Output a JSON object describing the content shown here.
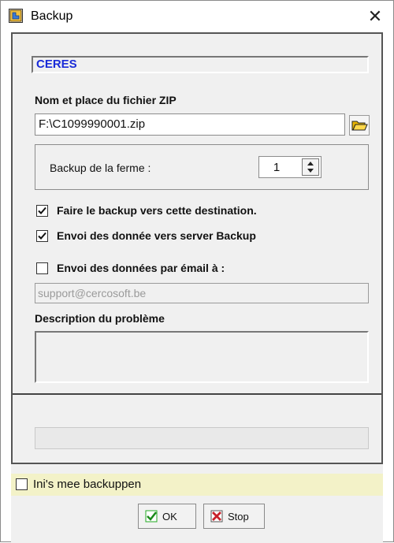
{
  "window": {
    "title": "Backup",
    "close_glyph": "✕"
  },
  "company": {
    "name": "CERES"
  },
  "zip": {
    "label": "Nom et place du fichier ZIP",
    "value": "F:\\C1099990001.zip"
  },
  "farm": {
    "label": "Backup de la ferme :",
    "value": "1"
  },
  "options": {
    "destination": {
      "label": "Faire le backup vers cette destination.",
      "checked": true
    },
    "server": {
      "label": "Envoi des donnée vers server Backup",
      "checked": true
    },
    "email": {
      "label": "Envoi des données par émail à :",
      "checked": false
    }
  },
  "email_field": {
    "value": "support@cercosoft.be"
  },
  "problem": {
    "label": "Description du problème",
    "value": ""
  },
  "ini": {
    "label": "Ini's mee backuppen",
    "checked": false
  },
  "buttons": {
    "ok": "OK",
    "stop": "Stop"
  },
  "colors": {
    "company_text": "#1a2bd8",
    "ini_bg": "#f3f2c8",
    "panel_bg": "#f0f0f0"
  },
  "icons": {
    "app": "backup-app-icon",
    "folder": "folder-open-icon",
    "ok": "ok-check-icon",
    "stop": "stop-x-icon"
  }
}
